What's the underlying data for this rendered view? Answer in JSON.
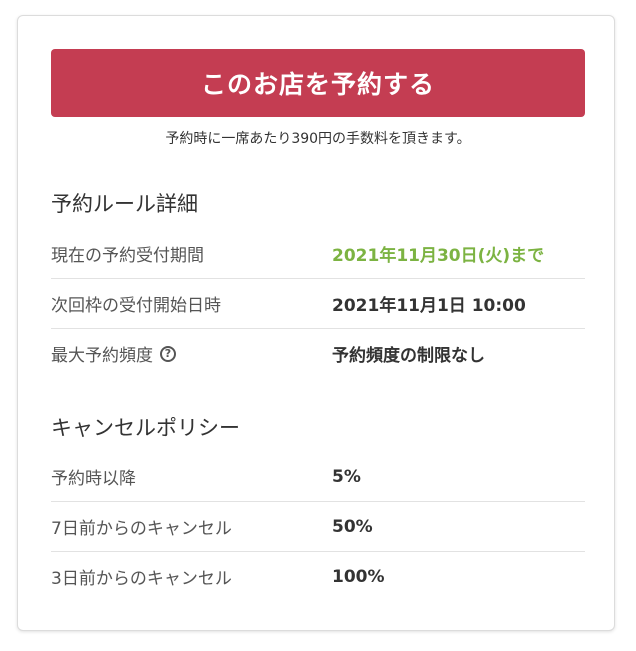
{
  "reserve_button": {
    "label": "このお店を予約する"
  },
  "fee_note": "予約時に一席あたり390円の手数料を頂きます。",
  "rules": {
    "title": "予約ルール詳細",
    "rows": [
      {
        "label": "現在の予約受付期間",
        "value": "2021年11月30日(火)まで"
      },
      {
        "label": "次回枠の受付開始日時",
        "value": "2021年11月1日 10:00"
      },
      {
        "label": "最大予約頻度",
        "value": "予約頻度の制限なし",
        "help_icon": "?"
      }
    ]
  },
  "cancel_policy": {
    "title": "キャンセルポリシー",
    "rows": [
      {
        "label": "予約時以降",
        "value": "5%"
      },
      {
        "label": "7日前からのキャンセル",
        "value": "50%"
      },
      {
        "label": "3日前からのキャンセル",
        "value": "100%"
      }
    ]
  },
  "colors": {
    "button_bg": "#c43d52",
    "accent_green": "#7cb342"
  },
  "icons": {
    "help": "help-circle-icon"
  }
}
